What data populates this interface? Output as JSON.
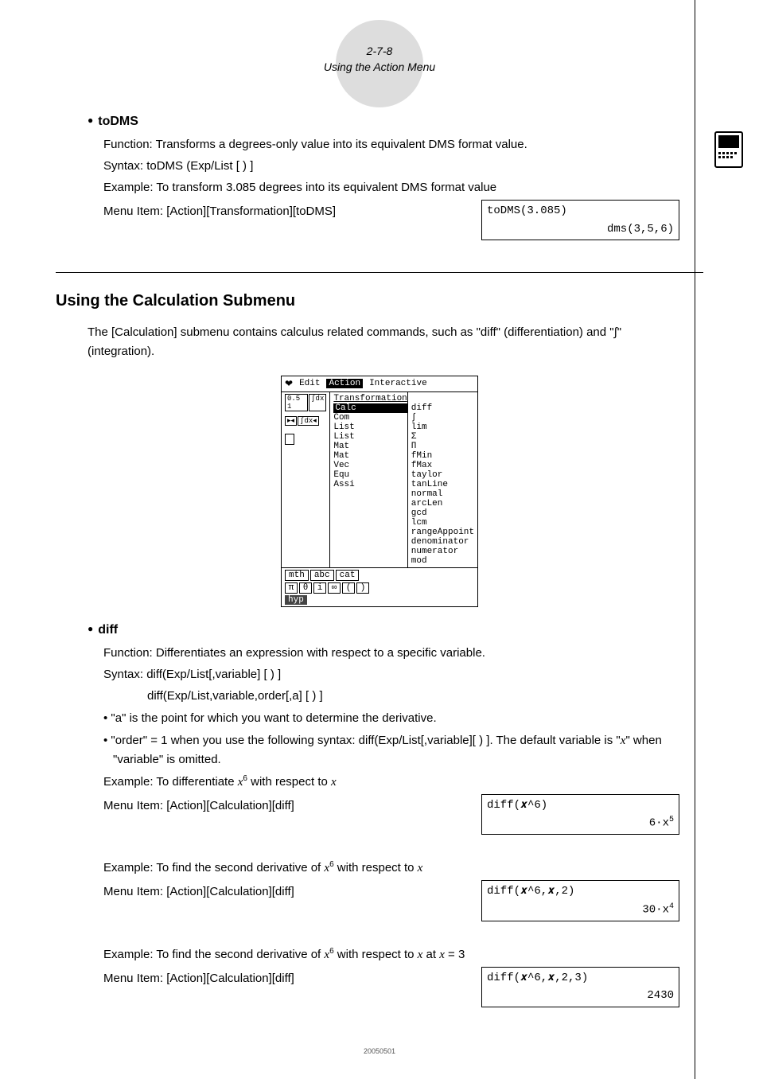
{
  "header": {
    "page_ref": "2-7-8",
    "title": "Using the Action Menu"
  },
  "todms": {
    "heading": "toDMS",
    "function": "Function: Transforms a degrees-only value into its equivalent DMS format value.",
    "syntax": "Syntax: toDMS (Exp/List [ ) ]",
    "example": "Example: To transform 3.085 degrees into its equivalent DMS format value",
    "menu_item": "Menu Item: [Action][Transformation][toDMS]",
    "calc_input": "toDMS(3.085)",
    "calc_output": "dms(3,5,6)"
  },
  "calc_section": {
    "title": "Using the Calculation Submenu",
    "intro": "The [Calculation] submenu contains calculus related commands, such as \"diff\" (differentiation) and \"∫\" (integration)."
  },
  "menu_screenshot": {
    "menubar": {
      "edit": "Edit",
      "action": "Action",
      "interactive": "Interactive"
    },
    "left_col": [
      "Calc",
      "Com",
      "List",
      "List",
      "Mat",
      "Mat",
      "Vec",
      "Equ",
      "Assi"
    ],
    "left_col_hdr": "Transformation",
    "right_col": [
      "diff",
      "∫",
      "lim",
      "Σ",
      "Π",
      "fMin",
      "fMax",
      "taylor",
      "tanLine",
      "normal",
      "arcLen",
      "gcd",
      "lcm",
      "rangeAppoint",
      "denominator",
      "numerator",
      "mod"
    ],
    "bottom_tabs": [
      "mth",
      "abc",
      "cat"
    ],
    "bottom_keys": [
      "π",
      "θ",
      "i",
      "∞",
      "(",
      ")"
    ],
    "bottom_hyp": "hyp"
  },
  "diff": {
    "heading": "diff",
    "function": "Function: Differentiates an expression with respect to a specific variable.",
    "syntax1": "Syntax: diff(Exp/List[,variable] [ ) ]",
    "syntax2": "diff(Exp/List,variable,order[,a] [ ) ]",
    "note_a": "\"a\" is the point for which you want to determine the derivative.",
    "note_order_pre": "\"order\" = 1 when you use the following syntax: diff(Exp/List[,variable][ ) ]. The default variable is \"",
    "note_order_var": "x",
    "note_order_post": "\" when \"variable\" is omitted.",
    "example1_pre": "Example: To differentiate ",
    "example1_expr_base": "x",
    "example1_expr_sup": "6",
    "example1_mid": " with respect to ",
    "example1_var": "x",
    "menu_item": "Menu Item: [Action][Calculation][diff]",
    "calc1_input": "diff(𝒙^6)",
    "calc1_output": "6·x",
    "calc1_output_sup": "5",
    "example2_pre": "Example: To find the second derivative of ",
    "example2_mid": " with respect to ",
    "calc2_input": "diff(𝒙^6,𝒙,2)",
    "calc2_output": "30·x",
    "calc2_output_sup": "4",
    "example3_pre": "Example: To find the second derivative of ",
    "example3_mid": " with respect to ",
    "example3_at": " at ",
    "example3_eq": " = 3",
    "calc3_input": "diff(𝒙^6,𝒙,2,3)",
    "calc3_output": "2430"
  },
  "footer": "20050501"
}
